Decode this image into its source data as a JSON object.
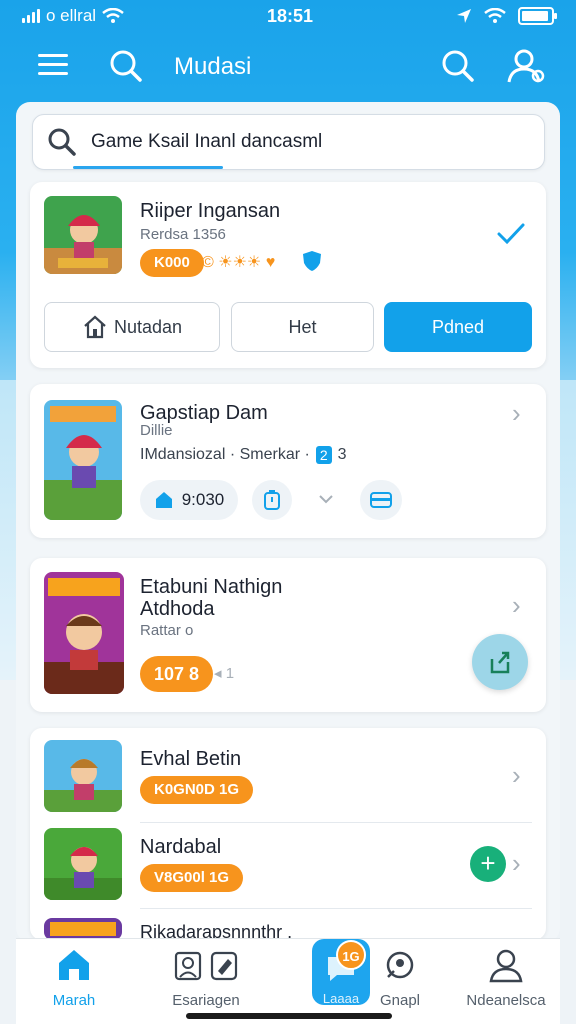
{
  "status_bar": {
    "carrier": "o ellral",
    "time": "18:51"
  },
  "app_bar": {
    "title": "Mudasi"
  },
  "search": {
    "value": "Game Ksail Inanl dancasml"
  },
  "games": [
    {
      "title": "Riiper Ingansan",
      "subtitle": "Rerdsa 1356",
      "badge": "K000",
      "rating_icons": "© ☀☀☀ ♥",
      "actions": [
        "Nutadan",
        "Het",
        "Pdned"
      ]
    },
    {
      "title": "Gapstiap Dam",
      "subtitle": "Dillie",
      "meta": "IMdansiozal · Smerkar ·",
      "meta_badge": "2",
      "meta_suffix": "3",
      "chip_value": "9:030"
    },
    {
      "title": "Etabuni Nathign Atdhoda",
      "subtitle": "Rattar o",
      "badge": "107 8",
      "extra": "◂ 1"
    },
    {
      "title": "Evhal Betin",
      "badge": "K0GN0D 1G"
    },
    {
      "title": "Nardabal",
      "badge": "V8G00l 1G"
    },
    {
      "title": "Rikadarapsnnnthr ."
    }
  ],
  "bottom_nav": {
    "items": [
      "Marah",
      "Esariagen",
      "Laaaa",
      "Gnapl",
      "Ndeanelsca"
    ],
    "badge": "1G"
  },
  "colors": {
    "accent": "#12a1ea",
    "orange": "#f7941d",
    "green": "#18b07a"
  }
}
